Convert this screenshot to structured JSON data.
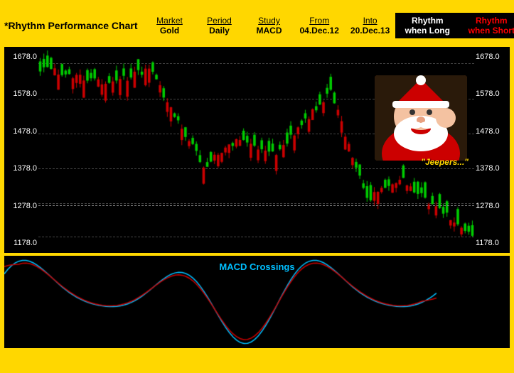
{
  "header": {
    "title": "*Rhythm Performance Chart",
    "columns": [
      {
        "label": "Market",
        "value": "Gold"
      },
      {
        "label": "Period",
        "value": "Daily"
      },
      {
        "label": "Study",
        "value": "MACD"
      },
      {
        "label": "From",
        "value": "04.Dec.12"
      },
      {
        "label": "Into",
        "value": "20.Dec.13"
      }
    ],
    "rhythm_long": {
      "line1": "Rhythm",
      "line2": "when Long"
    },
    "rhythm_short": {
      "line1": "Rhythm",
      "line2": "when Short"
    }
  },
  "chart": {
    "price_levels": [
      "1678.0",
      "1578.0",
      "1478.0",
      "1378.0",
      "1278.0",
      "1178.0"
    ],
    "jeepers_label": "\"Jeepers...\"",
    "macd_label": "MACD Crossings"
  }
}
